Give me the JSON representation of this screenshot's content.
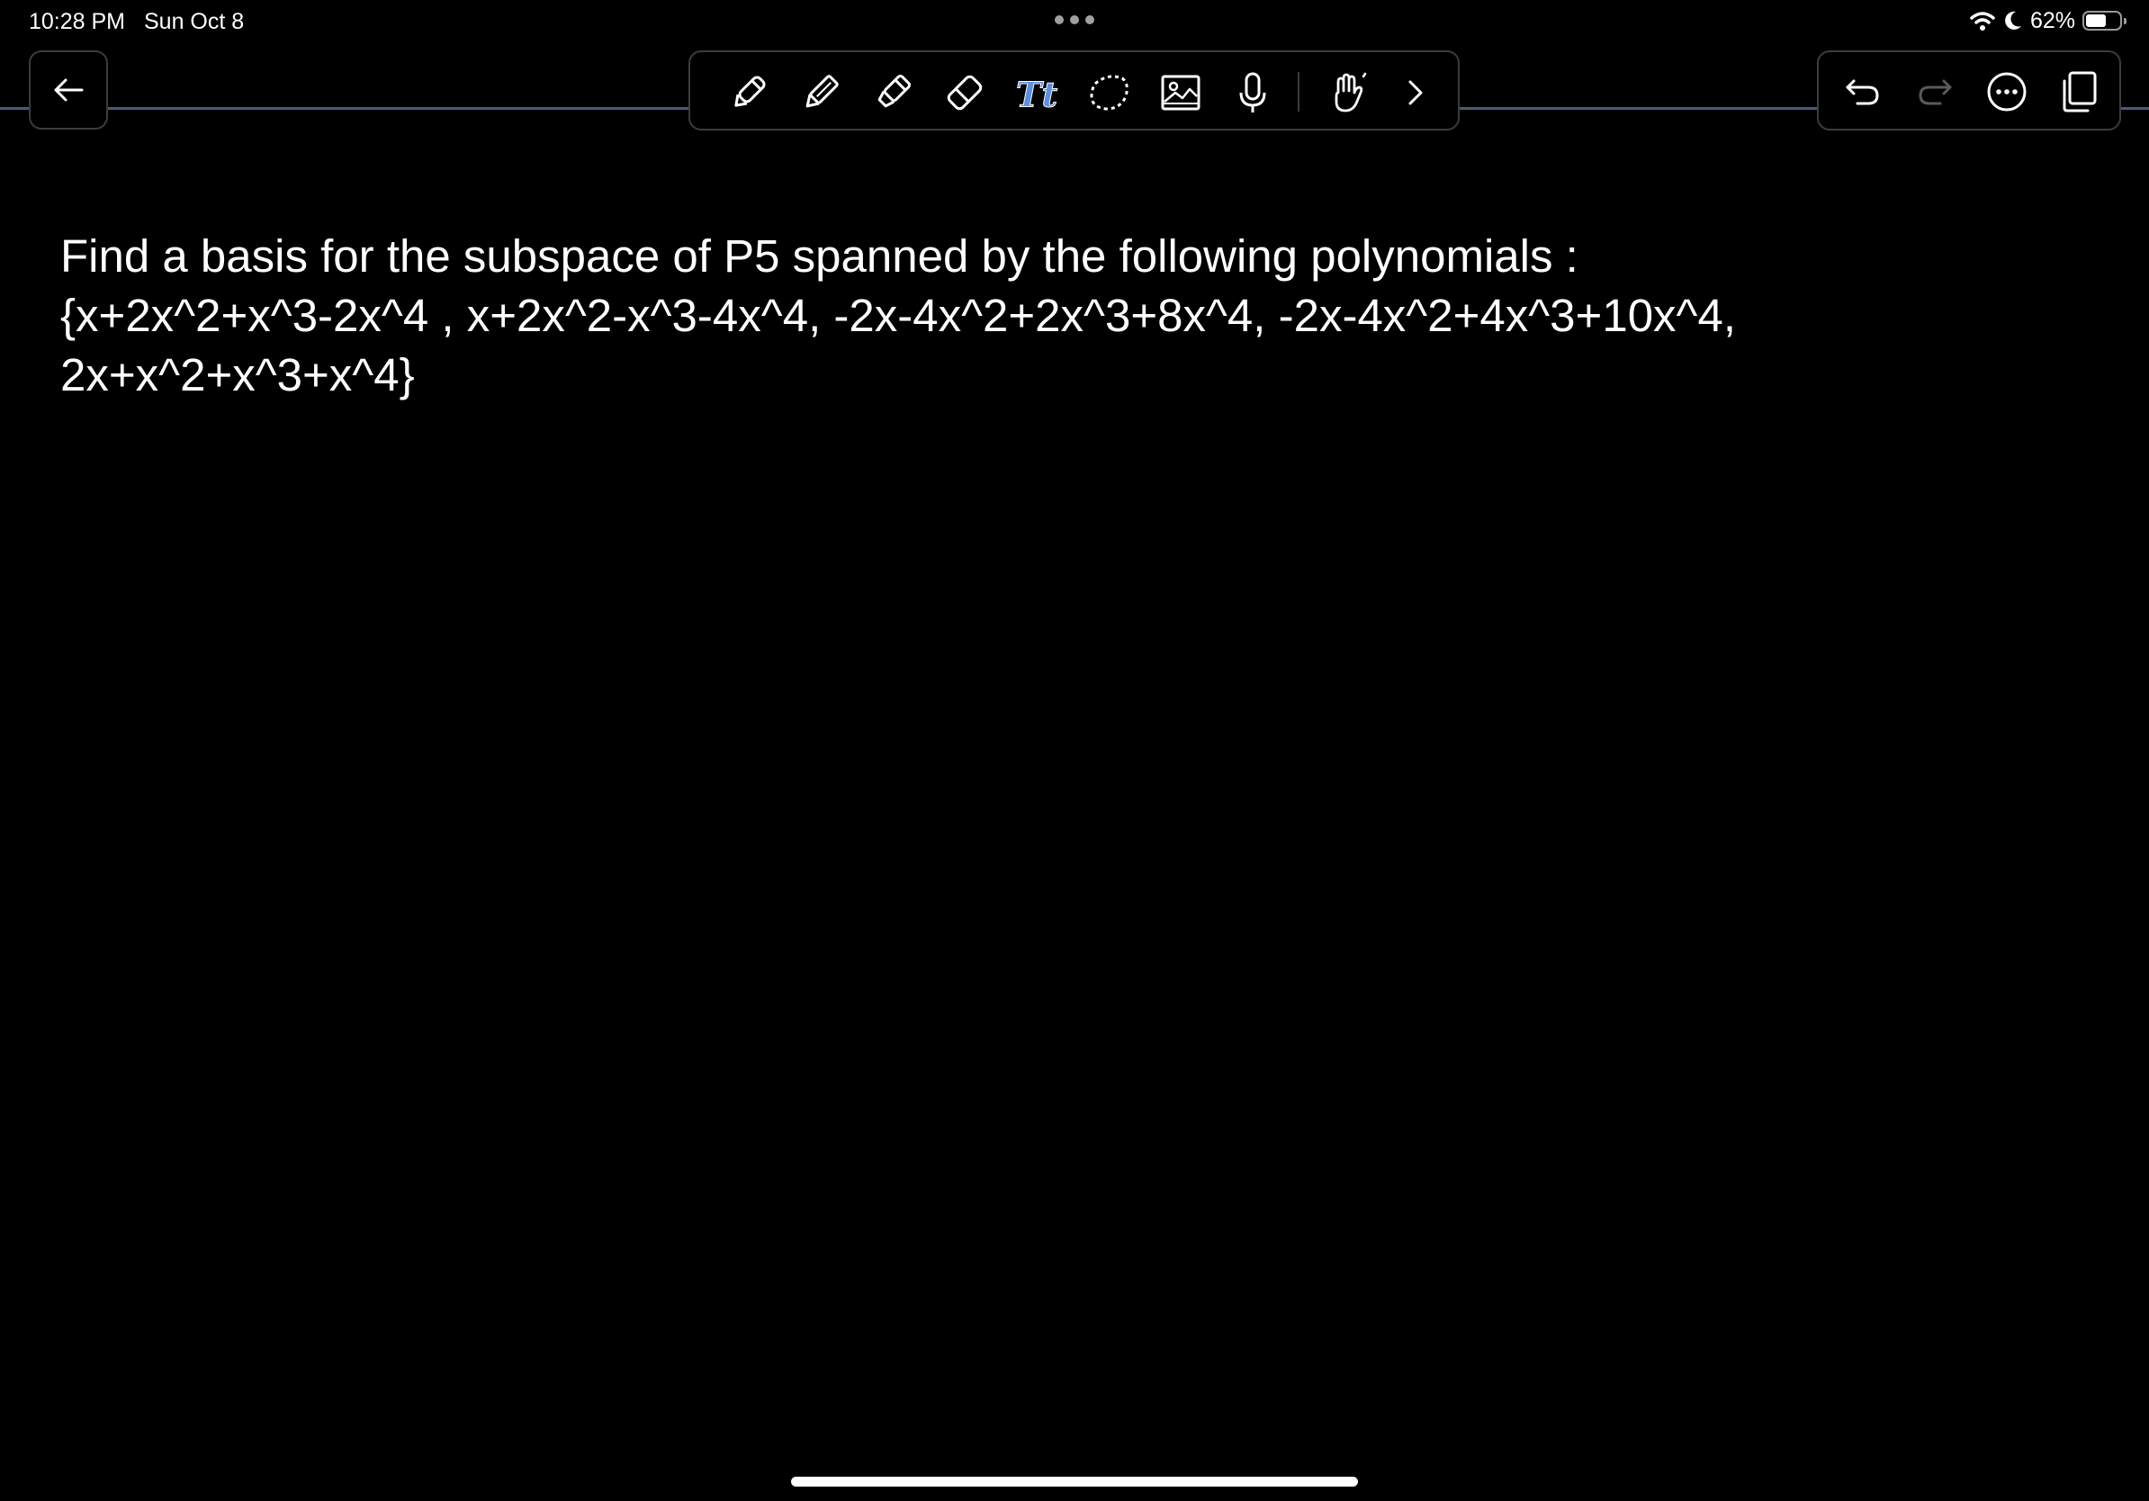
{
  "status_bar": {
    "time": "10:28 PM",
    "date": "Sun Oct 8",
    "battery_percent_label": "62%",
    "battery_level": 0.62,
    "icons": [
      "wifi-icon",
      "moon-icon",
      "battery-icon"
    ]
  },
  "header": {
    "back_icon": "arrow-left-icon",
    "toolbar_tools": [
      "pen-icon",
      "pencil-icon",
      "highlighter-icon",
      "eraser-icon",
      "text-tool-icon",
      "lasso-icon",
      "image-icon",
      "microphone-icon",
      "hand-gesture-icon",
      "chevron-right-icon"
    ],
    "action_icons": [
      "undo-icon",
      "redo-icon",
      "more-icon",
      "pages-icon"
    ],
    "accent_color": "#5b8fe6",
    "divider_color": "#4a5a78"
  },
  "note": {
    "lines": [
      "Find a basis for the subspace of P5 spanned by the following polynomials :",
      "{x+2x^2+x^3-2x^4 , x+2x^2-x^3-4x^4, -2x-4x^2+2x^3+8x^4, -2x-4x^2+4x^3+10x^4,",
      "2x+x^2+x^3+x^4}"
    ]
  }
}
